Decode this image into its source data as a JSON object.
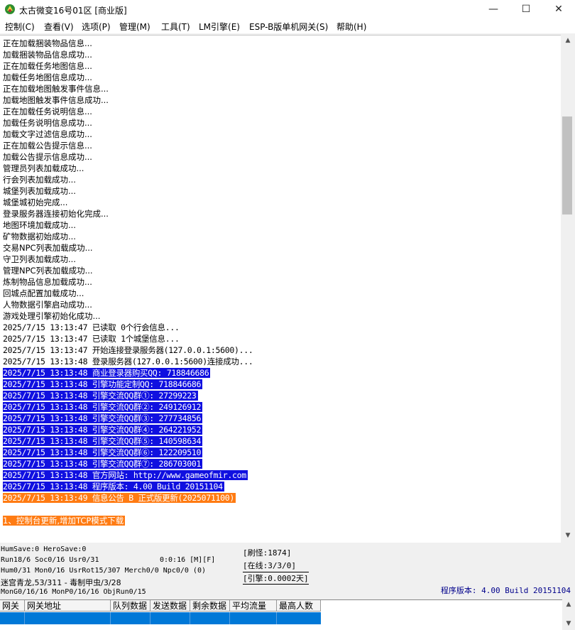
{
  "window": {
    "title": "太古微变16号01区 [商业版]",
    "minimize": "—",
    "maximize": "☐",
    "close": "✕"
  },
  "menu": [
    "控制(C)",
    "查看(V)",
    "选项(P)",
    "管理(M)",
    "工具(T)",
    "LM引擎(E)",
    "ESP-B版单机网关(S)",
    "帮助(H)"
  ],
  "log_plain": [
    "正在加载捆装物品信息...",
    "加载捆装物品信息成功...",
    "正在加载任务地图信息...",
    "加载任务地图信息成功...",
    "正在加载地图触发事件信息...",
    "加载地图触发事件信息成功...",
    "正在加载任务说明信息...",
    "加载任务说明信息成功...",
    "加载文字过滤信息成功...",
    "正在加载公告提示信息...",
    "加载公告提示信息成功...",
    "管理员列表加载成功...",
    "行会列表加载成功...",
    "城堡列表加载成功...",
    "城堡城初始完成...",
    "登录服务器连接初始化完成...",
    "地图环境加载成功...",
    "矿物数据初始成功...",
    "交易NPC列表加载成功...",
    "守卫列表加载成功...",
    "管理NPC列表加载成功...",
    "炼制物品信息加载成功...",
    "回城点配置加载成功...",
    "人物数据引擎启动成功...",
    "游戏处理引擎初始化成功...",
    "2025/7/15 13:13:47 已读取 0个行会信息...",
    "2025/7/15 13:13:47 已读取 1个城堡信息...",
    "2025/7/15 13:13:47 开始连接登录服务器(127.0.0.1:5600)...",
    "2025/7/15 13:13:48 登录服务器(127.0.0.1:5600)连接成功..."
  ],
  "log_highlight": [
    "2025/7/15 13:13:48 商业登录器购买QQ: 718846686",
    "2025/7/15 13:13:48 引擎功能定制QQ: 718846686",
    "2025/7/15 13:13:48 引擎交流QQ群①: 27299223",
    "2025/7/15 13:13:48 引擎交流QQ群②: 249126912",
    "2025/7/15 13:13:48 引擎交流QQ群③: 277734856",
    "2025/7/15 13:13:48 引擎交流QQ群④: 264221952",
    "2025/7/15 13:13:48 引擎交流QQ群⑤: 140598634",
    "2025/7/15 13:13:48 引擎交流QQ群⑥: 122209510",
    "2025/7/15 13:13:48 引擎交流QQ群⑦: 286703001",
    "2025/7/15 13:13:48 官方网站: http://www.gameofmir.com",
    "2025/7/15 13:13:48 程序版本: 4.00 Build 20151104"
  ],
  "log_notice": "2025/7/15 13:13:49 信息公告 B 正式版更新(2025071100)",
  "log_update": "1、控制台更新,增加TCP模式下载",
  "status": {
    "line1": "HumSave:0 HeroSave:0",
    "line2a": "Run18/6 Soc0/16 Usr0/31",
    "line2b": "0:0:16 [M][F]",
    "line3": "Hum0/31 Mon0/16 UsrRot15/307 Merch0/0 Npc0/0 (0)",
    "line4": "迷宫青龙,53/311 - 毒制甲虫/3/28",
    "line5": "MonG0/16/16 MonP0/16/16 ObjRun0/15",
    "refresh": "[刷怪:1874]",
    "online": "[在线:3/3/0]",
    "engine": "[引擎:0.0002天]",
    "version": "程序版本: 4.00 Build 20151104"
  },
  "grid": {
    "headers": [
      "网关",
      "网关地址",
      "队列数据",
      "发送数据",
      "剩余数据",
      "平均流量",
      "最高人数"
    ]
  }
}
